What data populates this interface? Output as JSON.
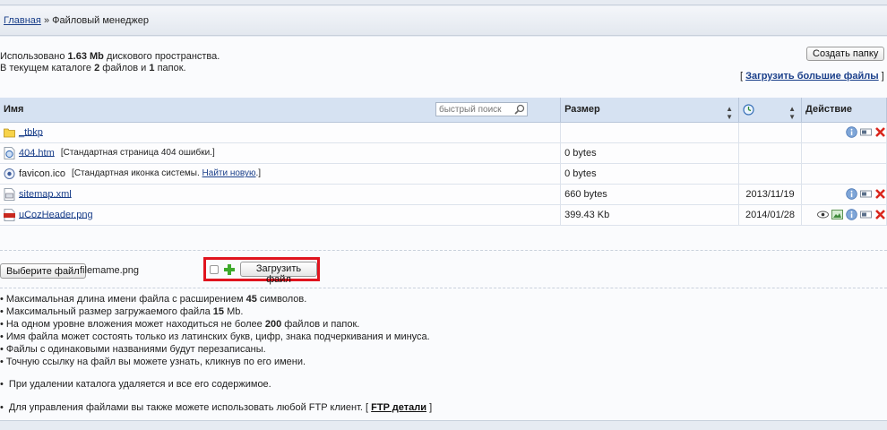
{
  "breadcrumb": {
    "home": "Главная",
    "separator": "»",
    "current": "Файловый менеджер"
  },
  "info": {
    "line1_prefix": "Использовано",
    "used": "1.63 Mb",
    "line1_suffix": "дискового пространства.",
    "line2_prefix": "В текущем каталоге",
    "files": "2",
    "line2_mid": "файлов и",
    "folders": "1",
    "line2_suffix": "папок."
  },
  "buttons": {
    "create_folder": "Создать папку",
    "upload_large_open": "[",
    "upload_large": "Загрузить большие файлы",
    "upload_large_close": "]"
  },
  "table": {
    "headers": {
      "name": "Имя",
      "size": "Размер",
      "action": "Действие"
    },
    "quick_search_placeholder": "быстрый поиск",
    "rows": [
      {
        "name": "_tbkp",
        "desc": "",
        "size": "",
        "date": ""
      },
      {
        "name": "404.htm",
        "desc": "[Стандартная страница 404 ошибки.]",
        "size": "0 bytes",
        "date": ""
      },
      {
        "name": "favicon.ico",
        "desc_prefix": "[Стандартная иконка системы.",
        "desc_link": "Найти новую",
        "desc_suffix": ".]",
        "size": "0 bytes",
        "date": ""
      },
      {
        "name": "sitemap.xml",
        "desc": "",
        "size": "660 bytes",
        "date": "2013/11/19"
      },
      {
        "name": "uCozHeader.png",
        "desc": "",
        "size": "399.43 Kb",
        "date": "2014/01/28"
      }
    ]
  },
  "upload": {
    "choose_label": "Выберите файл",
    "chosen_file": "filemame.png",
    "upload_label": "Загрузить файл"
  },
  "rules": [
    {
      "text": "Максимальная длина имени файла с расширением",
      "value": "45",
      "suffix": "символов."
    },
    {
      "text": "Максимальный размер загружаемого файла",
      "value": "15",
      "suffix": "Mb."
    },
    {
      "text": "На одном уровне вложения может находиться не более",
      "value": "200",
      "suffix": "файлов и папок."
    },
    {
      "text": "Имя файла может состоять только из латинских букв, цифр, знака подчеркивания и минуса.",
      "value": "",
      "suffix": ""
    },
    {
      "text": "Файлы с одинаковыми названиями будут перезаписаны.",
      "value": "",
      "suffix": ""
    },
    {
      "text": "Точную ссылку на файл вы можете узнать, кликнув по его имени.",
      "value": "",
      "suffix": ""
    }
  ],
  "notes": {
    "delete_note": "При удалении каталога удаляется и все его содержимое.",
    "ftp_prefix": "Для управления файлами вы также можете использовать любой FTP клиент. [",
    "ftp_link": "FTP детали",
    "ftp_suffix": "]"
  },
  "colors": {
    "link": "#1a3f8a",
    "header_bg": "#d6e2f2",
    "highlight_border": "#e0141e",
    "delete_red": "#d9261c"
  }
}
